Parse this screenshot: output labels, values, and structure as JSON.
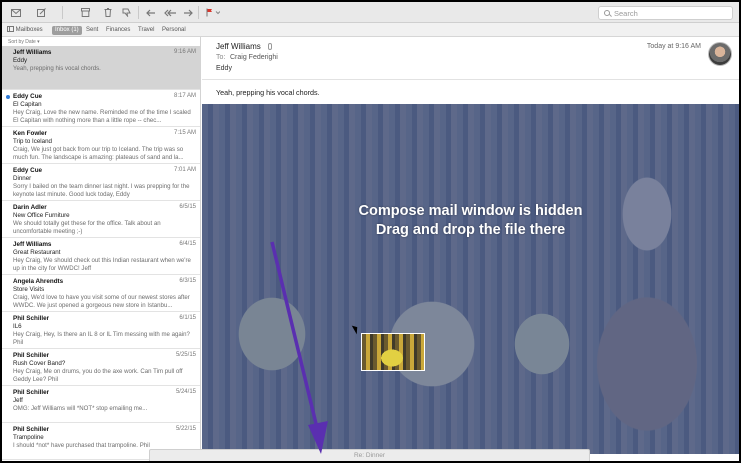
{
  "toolbar": {
    "buttons": [
      "get-mail",
      "compose",
      "archive",
      "trash",
      "junk",
      "reply",
      "reply-all",
      "forward",
      "flag"
    ],
    "search_placeholder": "Search"
  },
  "favorites": {
    "mailboxes": "Mailboxes",
    "inbox": "Inbox (1)",
    "sent": "Sent",
    "finances": "Finances",
    "travel": "Travel",
    "personal": "Personal"
  },
  "list": {
    "sort_label": "Sort by Date ▾",
    "messages": [
      {
        "from": "Jeff Williams",
        "date": "9:16 AM",
        "subject": "Eddy",
        "preview": "Yeah, prepping his vocal chords.",
        "selected": true,
        "unread": false
      },
      {
        "from": "Eddy Cue",
        "date": "8:17 AM",
        "subject": "El Capitan",
        "preview": "Hey Craig, Love the new name. Reminded me of the time I scaled El Capitan with nothing more than a little rope -- chec...",
        "selected": false,
        "unread": true
      },
      {
        "from": "Ken Fowler",
        "date": "7:15 AM",
        "subject": "Trip to Iceland",
        "preview": "Craig, We just got back from our trip to Iceland. The trip was so much fun. The landscape is amazing: plateaus of sand and la...",
        "selected": false,
        "unread": false
      },
      {
        "from": "Eddy Cue",
        "date": "7:01 AM",
        "subject": "Dinner",
        "preview": "Sorry I bailed on the team dinner last night. I was prepping for the keynote last minute. Good luck today, Eddy",
        "selected": false,
        "unread": false
      },
      {
        "from": "Darin Adler",
        "date": "6/5/15",
        "subject": "New Office Furniture",
        "preview": "We should totally get these for the office. Talk about an uncomfortable meeting ;-)",
        "selected": false,
        "unread": false
      },
      {
        "from": "Jeff Williams",
        "date": "6/4/15",
        "subject": "Great Restaurant",
        "preview": "Hey Craig, We should check out this Indian restaurant when we're up in the city for WWDC! Jeff",
        "selected": false,
        "unread": false
      },
      {
        "from": "Angela Ahrendts",
        "date": "6/3/15",
        "subject": "Store Visits",
        "preview": "Craig, We'd love to have you visit some of our newest stores after WWDC. We just opened a gorgeous new store in Istanbu...",
        "selected": false,
        "unread": false
      },
      {
        "from": "Phil Schiller",
        "date": "6/1/15",
        "subject": "IL6",
        "preview": "Hey Craig, Hey, Is there an IL 8 or IL Tim messing with me again? Phil",
        "selected": false,
        "unread": false
      },
      {
        "from": "Phil Schiller",
        "date": "5/25/15",
        "subject": "Rush Cover Band?",
        "preview": "Hey Craig, Me on drums, you do the axe work. Can Tim pull off Geddy Lee? Phil",
        "selected": false,
        "unread": false
      },
      {
        "from": "Phil Schiller",
        "date": "5/24/15",
        "subject": "Jeff",
        "preview": "OMG: Jeff Williams will *NOT* stop emailing me...",
        "selected": false,
        "unread": false
      },
      {
        "from": "Phil Schiller",
        "date": "5/22/15",
        "subject": "Trampoline",
        "preview": "I should *not* have purchased that trampoline. Phil",
        "selected": false,
        "unread": false
      }
    ]
  },
  "reader": {
    "from": "Jeff Williams",
    "to_label": "To:",
    "to": "Craig Federighi",
    "subject": "Eddy",
    "date": "Today at 9:16 AM",
    "body": "Yeah, prepping his vocal chords."
  },
  "overlay": {
    "line1": "Compose mail window is hidden",
    "line2": "Drag and drop the file there",
    "arrow_color": "#5a2fb0",
    "tint_color": "#4862a5"
  },
  "compose": {
    "title": "Re: Dinner"
  }
}
